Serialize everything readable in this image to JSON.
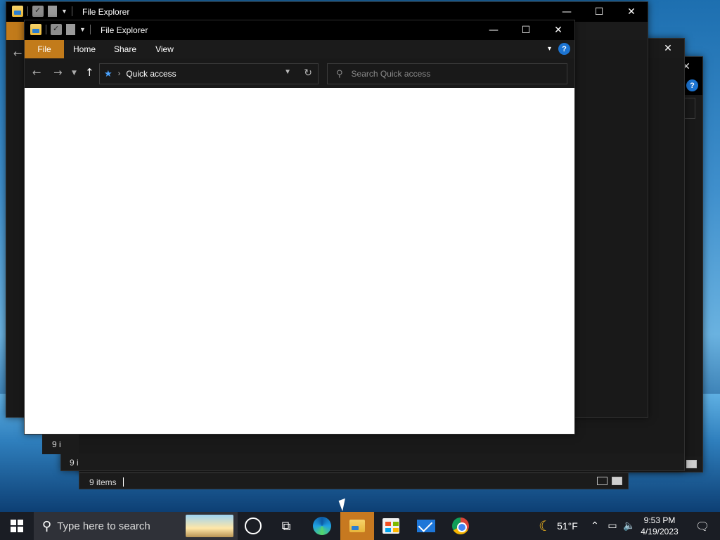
{
  "app_name": "File Explorer",
  "ribbon": {
    "tabs": [
      {
        "label": "File",
        "active": true
      },
      {
        "label": "Home"
      },
      {
        "label": "Share"
      },
      {
        "label": "View"
      }
    ]
  },
  "address_bar": {
    "location": "Quick access"
  },
  "search": {
    "placeholder": "Search Quick access"
  },
  "status": {
    "items_count": "9 items"
  },
  "status_fragments": {
    "back1": "9 i",
    "back2": "9 i"
  },
  "caption": {
    "minimize": "—",
    "maximize": "☐",
    "close": "✕"
  },
  "taskbar": {
    "search_placeholder": "Type here to search",
    "weather_temp": "51°F",
    "time": "9:53 PM",
    "date": "4/19/2023"
  },
  "icons": {
    "folder": "folder-icon",
    "help": "?",
    "back": "←",
    "forward": "→",
    "up": "↑",
    "refresh": "↻"
  },
  "colors": {
    "file_tab": "#c27b1b",
    "titlebar": "#000000",
    "accent_blue": "#1c74d2"
  }
}
